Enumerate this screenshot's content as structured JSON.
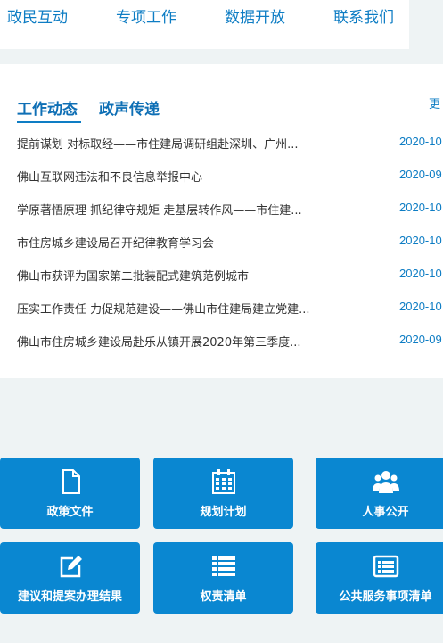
{
  "nav": {
    "items": [
      "政民互动",
      "专项工作",
      "数据开放",
      "联系我们"
    ]
  },
  "news": {
    "tabs": [
      "工作动态",
      "政声传递"
    ],
    "more": "更",
    "items": [
      {
        "title": "提前谋划 对标取经——市住建局调研组赴深圳、广州...",
        "date": "2020-10"
      },
      {
        "title": "佛山互联网违法和不良信息举报中心",
        "date": "2020-09"
      },
      {
        "title": "学原著悟原理 抓纪律守规矩 走基层转作风——市住建...",
        "date": "2020-10"
      },
      {
        "title": "市住房城乡建设局召开纪律教育学习会",
        "date": "2020-10"
      },
      {
        "title": "佛山市获评为国家第二批装配式建筑范例城市",
        "date": "2020-10"
      },
      {
        "title": "压实工作责任 力促规范建设——佛山市住建局建立党建...",
        "date": "2020-10"
      },
      {
        "title": "佛山市住房城乡建设局赴乐从镇开展2020年第三季度...",
        "date": "2020-09"
      }
    ]
  },
  "services": [
    {
      "label": "政策文件",
      "icon": "document-icon"
    },
    {
      "label": "规划计划",
      "icon": "calendar-icon"
    },
    {
      "label": "人事公开",
      "icon": "users-icon"
    },
    {
      "label": "建议和提案办理结果",
      "icon": "edit-icon"
    },
    {
      "label": "权责清单",
      "icon": "list-icon"
    },
    {
      "label": "公共服务事项清单",
      "icon": "list-alt-icon"
    }
  ],
  "colors": {
    "accent": "#0e7dc4",
    "tile": "#0a87d1"
  }
}
